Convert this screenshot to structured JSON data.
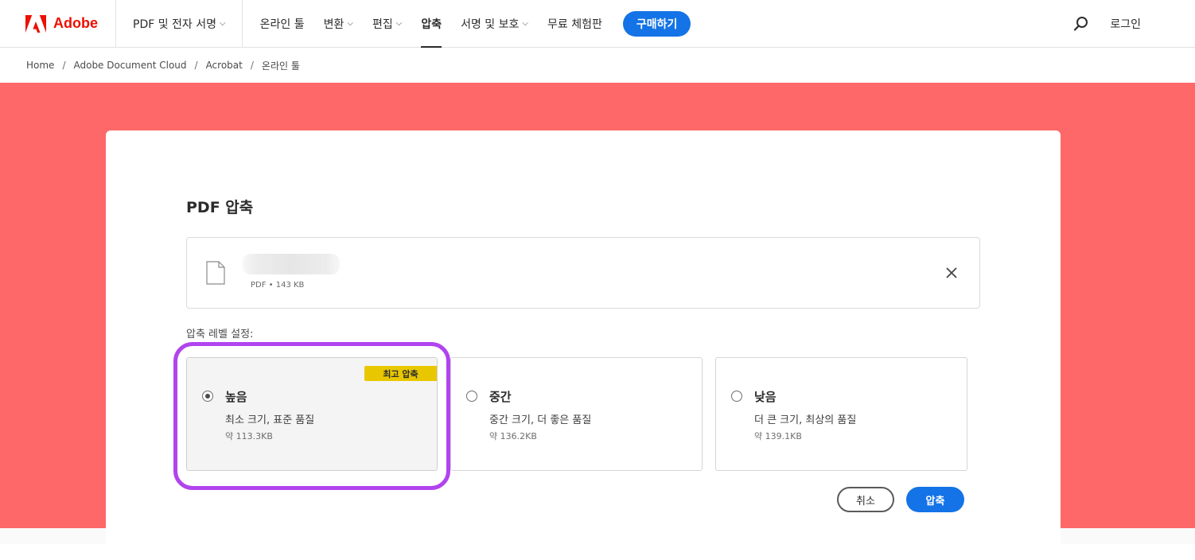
{
  "header": {
    "brand": "Adobe",
    "product_menu": "PDF 및 전자 서명",
    "nav": [
      {
        "label": "온라인 툴",
        "has_menu": false,
        "active": false
      },
      {
        "label": "변환",
        "has_menu": true,
        "active": false
      },
      {
        "label": "편집",
        "has_menu": true,
        "active": false
      },
      {
        "label": "압축",
        "has_menu": false,
        "active": true
      },
      {
        "label": "서명 및 보호",
        "has_menu": true,
        "active": false
      },
      {
        "label": "무료 체험판",
        "has_menu": false,
        "active": false
      }
    ],
    "buy_button": "구매하기",
    "login": "로그인",
    "search_icon": "search-icon",
    "colors": {
      "brand_red": "#eb1000",
      "accent_blue": "#1473e6"
    }
  },
  "breadcrumb": [
    "Home",
    "Adobe Document Cloud",
    "Acrobat",
    "온라인 툴"
  ],
  "breadcrumb_separator": "/",
  "hero": {
    "background": "#fe6868"
  },
  "card": {
    "title": "PDF 압축",
    "file": {
      "meta": "PDF • 143 KB",
      "icon": "file-icon",
      "remove_icon": "close-icon"
    },
    "level_label": "압축 레벨 설정:",
    "options": [
      {
        "key": "high",
        "title": "높음",
        "desc": "최소 크기, 표준 품질",
        "size": "약 113.3KB",
        "badge": "최고 압축",
        "selected": true
      },
      {
        "key": "mid",
        "title": "중간",
        "desc": "중간 크기, 더 좋은 품질",
        "size": "약 136.2KB",
        "selected": false
      },
      {
        "key": "low",
        "title": "낮음",
        "desc": "더 큰 크기, 최상의 품질",
        "size": "약 139.1KB",
        "selected": false
      }
    ],
    "cancel_button": "취소",
    "compress_button": "압축",
    "highlight_color": "#b044ee",
    "badge_color": "#e9c700"
  }
}
